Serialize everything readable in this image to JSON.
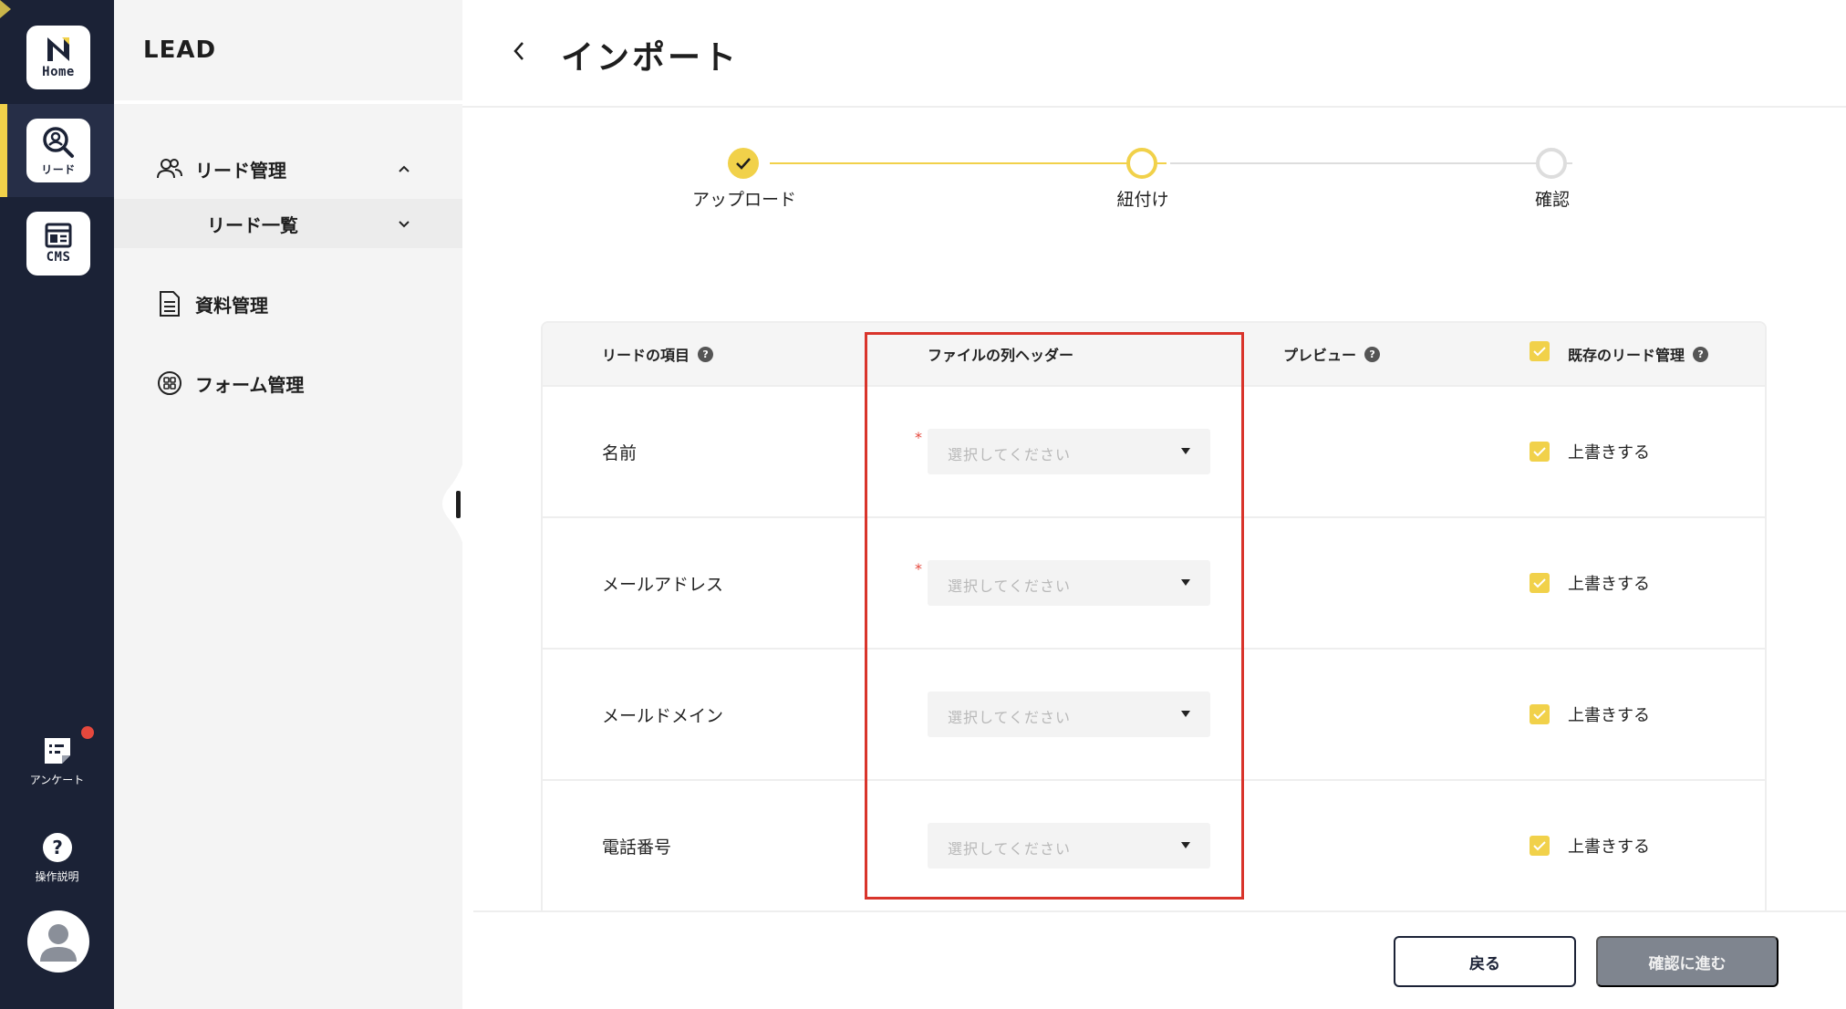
{
  "rail": {
    "home_label": "Home",
    "lead_label": "リード",
    "cms_label": "CMS",
    "survey_label": "アンケート",
    "help_label": "操作説明"
  },
  "sidebar": {
    "title": "LEAD",
    "items": [
      {
        "label": "リード管理",
        "icon": "users-icon",
        "expanded": true
      },
      {
        "label": "リード一覧",
        "icon": "",
        "expanded": false
      },
      {
        "label": "資料管理",
        "icon": "document-icon"
      },
      {
        "label": "フォーム管理",
        "icon": "grid-circle-icon"
      }
    ]
  },
  "header": {
    "title": "インポート"
  },
  "stepper": {
    "steps": [
      {
        "label": "アップロード",
        "state": "done"
      },
      {
        "label": "紐付け",
        "state": "current"
      },
      {
        "label": "確認",
        "state": "pending"
      }
    ]
  },
  "table": {
    "headers": {
      "lead_field": "リードの項目",
      "file_header": "ファイルの列ヘッダー",
      "preview": "プレビュー",
      "existing": "既存のリード管理"
    },
    "rows": [
      {
        "field": "名前",
        "required": true,
        "placeholder": "選択してください",
        "overwrite": "上書きする"
      },
      {
        "field": "メールアドレス",
        "required": true,
        "placeholder": "選択してください",
        "overwrite": "上書きする"
      },
      {
        "field": "メールドメイン",
        "required": false,
        "placeholder": "選択してください",
        "overwrite": "上書きする"
      },
      {
        "field": "電話番号",
        "required": false,
        "placeholder": "選択してください",
        "overwrite": "上書きする"
      }
    ],
    "required_mark": "*"
  },
  "footer": {
    "back_label": "戻る",
    "next_label": "確認に進む"
  },
  "colors": {
    "accent": "#f1d14a",
    "rail": "#1b2236",
    "highlight": "#d9342b",
    "disabled": "#7f858f"
  }
}
